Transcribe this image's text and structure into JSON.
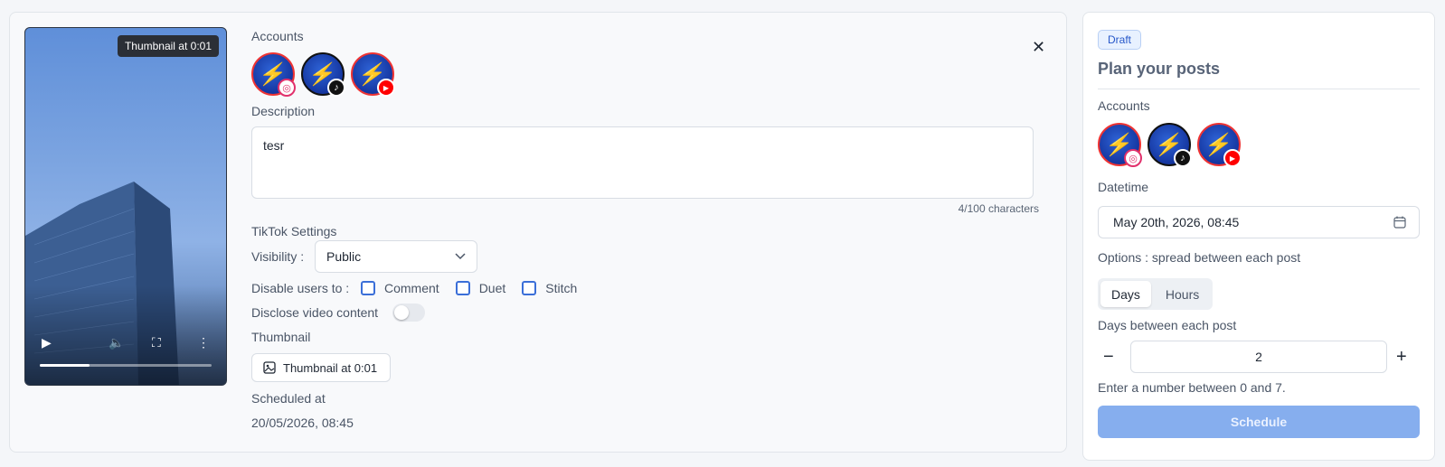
{
  "video": {
    "tooltip": "Thumbnail at 0:01",
    "progress_fraction": 0.29
  },
  "left": {
    "accounts_label": "Accounts",
    "description_label": "Description",
    "description_value": "tesr",
    "char_count": "4/100 characters",
    "tiktok_settings_label": "TikTok Settings",
    "visibility_label": "Visibility :",
    "visibility_value": "Public",
    "disable_label": "Disable users to :",
    "disable_options": [
      "Comment",
      "Duet",
      "Stitch"
    ],
    "disclose_label": "Disclose video content",
    "thumbnail_label": "Thumbnail",
    "thumbnail_button": "Thumbnail at 0:01",
    "scheduled_label": "Scheduled at",
    "scheduled_value": "20/05/2026, 08:45"
  },
  "right": {
    "status_badge": "Draft",
    "title": "Plan your posts",
    "accounts_label": "Accounts",
    "datetime_label": "Datetime",
    "datetime_value": "May 20th, 2026, 08:45",
    "options_label": "Options : spread between each post",
    "segments": [
      "Days",
      "Hours"
    ],
    "active_segment": "Days",
    "days_between_label": "Days between each post",
    "days_between_value": "2",
    "hint": "Enter a number between 0 and 7.",
    "schedule_button": "Schedule"
  },
  "accounts": [
    {
      "platform": "instagram",
      "icon": "instagram-icon"
    },
    {
      "platform": "tiktok",
      "icon": "tiktok-icon"
    },
    {
      "platform": "youtube",
      "icon": "youtube-icon"
    }
  ],
  "colors": {
    "accent": "#3b6fd8",
    "schedule_button_disabled": "#86aeee",
    "draft_badge": "#2657c9"
  }
}
